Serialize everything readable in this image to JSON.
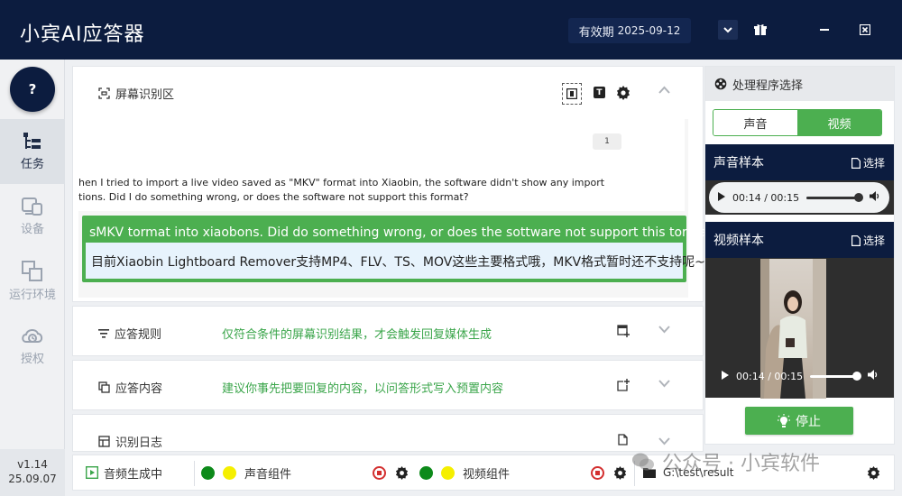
{
  "titlebar": {
    "app_title": "小宾AI应答器",
    "expiry_label": "有效期",
    "expiry_date": "2025-09-12"
  },
  "sidebar": {
    "help": "?",
    "items": [
      {
        "label": "任务",
        "icon": "tasks-icon",
        "active": true
      },
      {
        "label": "设备",
        "icon": "devices-icon"
      },
      {
        "label": "运行环境",
        "icon": "environment-icon"
      },
      {
        "label": "授权",
        "icon": "license-icon"
      }
    ],
    "version": "v1.14",
    "version_date": "25.09.07"
  },
  "screen_panel": {
    "title": "屏幕识别区",
    "ocr_badge": "1",
    "ocr_line1": "hen I tried to import a live video saved as \"MKV\" format into Xiaobin, the software didn't show any import",
    "ocr_line2": "tions. Did I do something wrong, or does the software not support this format?",
    "match_question": "sMKV tormat into xiaobons. Did do something wrong, or does the sottware not support this tormat?",
    "match_answer": "目前Xiaobin Lightboard Remover支持MP4、FLV、TS、MOV这些主要格式哦，MKV格式暂时还不支持呢~"
  },
  "rules_panel": {
    "title": "应答规则",
    "desc": "仅符合条件的屏幕识别结果，才会触发回复媒体生成"
  },
  "content_panel": {
    "title": "应答内容",
    "desc": "建议你事先把要回复的内容，以问答形式写入预置内容"
  },
  "log_panel": {
    "title": "识别日志"
  },
  "right_panel": {
    "title": "处理程序选择",
    "tab_audio": "声音",
    "tab_video": "视频",
    "audio_sample_title": "声音样本",
    "audio_pick": "选择",
    "audio_time": "00:14 / 00:15",
    "audio_progress": 0.93,
    "video_sample_title": "视频样本",
    "video_pick": "选择",
    "video_time": "00:14 / 00:15",
    "video_progress": 0.93,
    "stop": "停止"
  },
  "statusbar": {
    "status": "音频生成中",
    "audio_component": "声音组件",
    "video_component": "视频组件",
    "path": "G:\\test\\result"
  },
  "watermark": "公众号 · 小宾软件",
  "colors": {
    "navy": "#0c1c3f",
    "green": "#4caf50",
    "accent_text": "#3aa54a"
  }
}
